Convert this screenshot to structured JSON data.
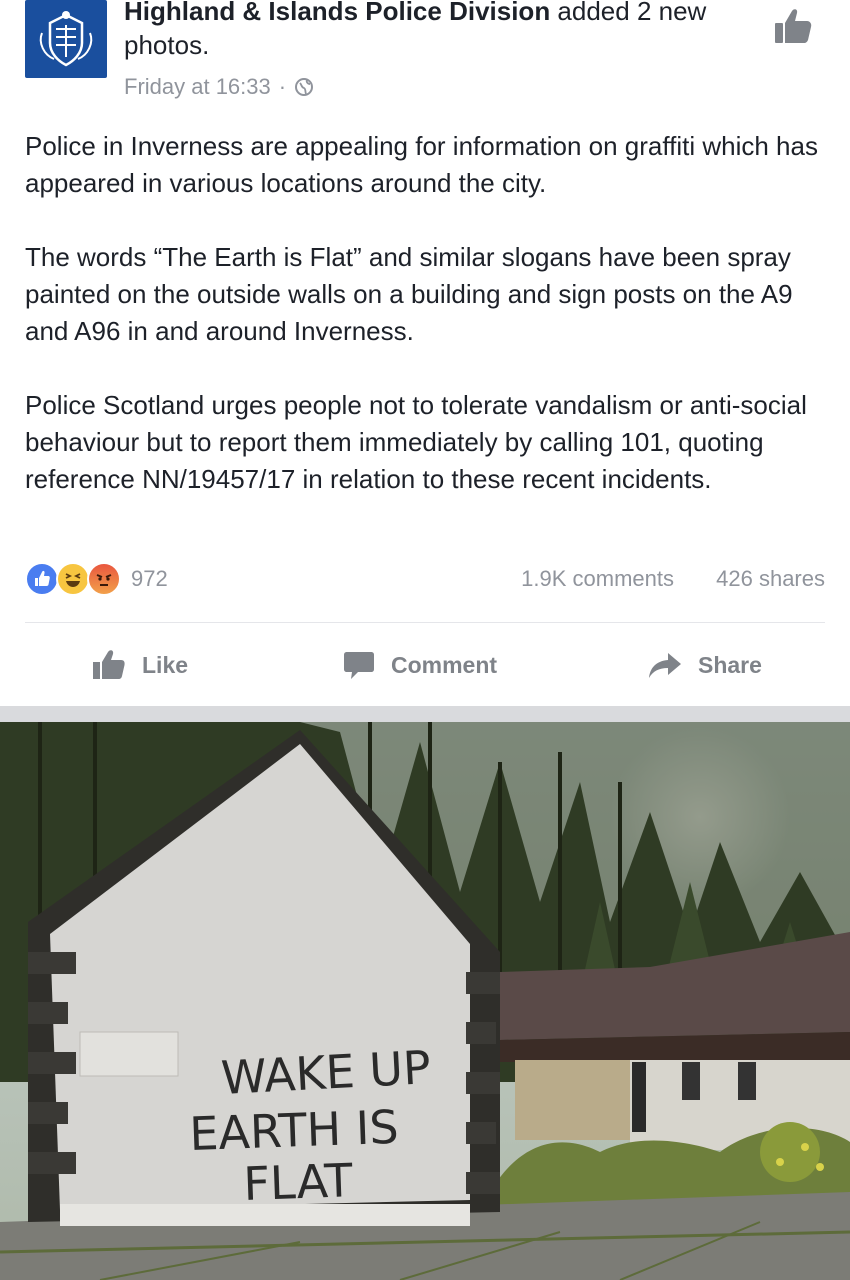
{
  "post": {
    "page_name": "Highland & Islands Police Division",
    "action_text": " added 2 new photos.",
    "timestamp": "Friday at 16:33",
    "separator": "·",
    "privacy_icon": "globe-icon",
    "paragraphs": [
      "Police in Inverness are appealing for information on graffiti which has appeared in various locations around the city.",
      "The words “The Earth is Flat” and similar slogans have been spray painted on the outside walls on a building and sign posts on the A9 and A96 in and around Inverness.",
      "Police Scotland urges people not to tolerate vandalism or anti-social behaviour but to report them immediately by calling 101, quoting reference NN/19457/17 in relation to these recent incidents."
    ]
  },
  "stats": {
    "reaction_count": "972",
    "comments": "1.9K comments",
    "shares": "426 shares",
    "reactions": [
      "like-reaction-icon",
      "haha-reaction-icon",
      "angry-reaction-icon"
    ]
  },
  "actions": {
    "like": "Like",
    "comment": "Comment",
    "share": "Share"
  },
  "photo": {
    "graffiti_lines": [
      "WAKE UP",
      "EARTH IS",
      "FLAT"
    ]
  },
  "colors": {
    "brand_blue": "#1a4f9e",
    "text": "#1d2129",
    "muted": "#90949c",
    "action_gray": "#7f8389"
  }
}
